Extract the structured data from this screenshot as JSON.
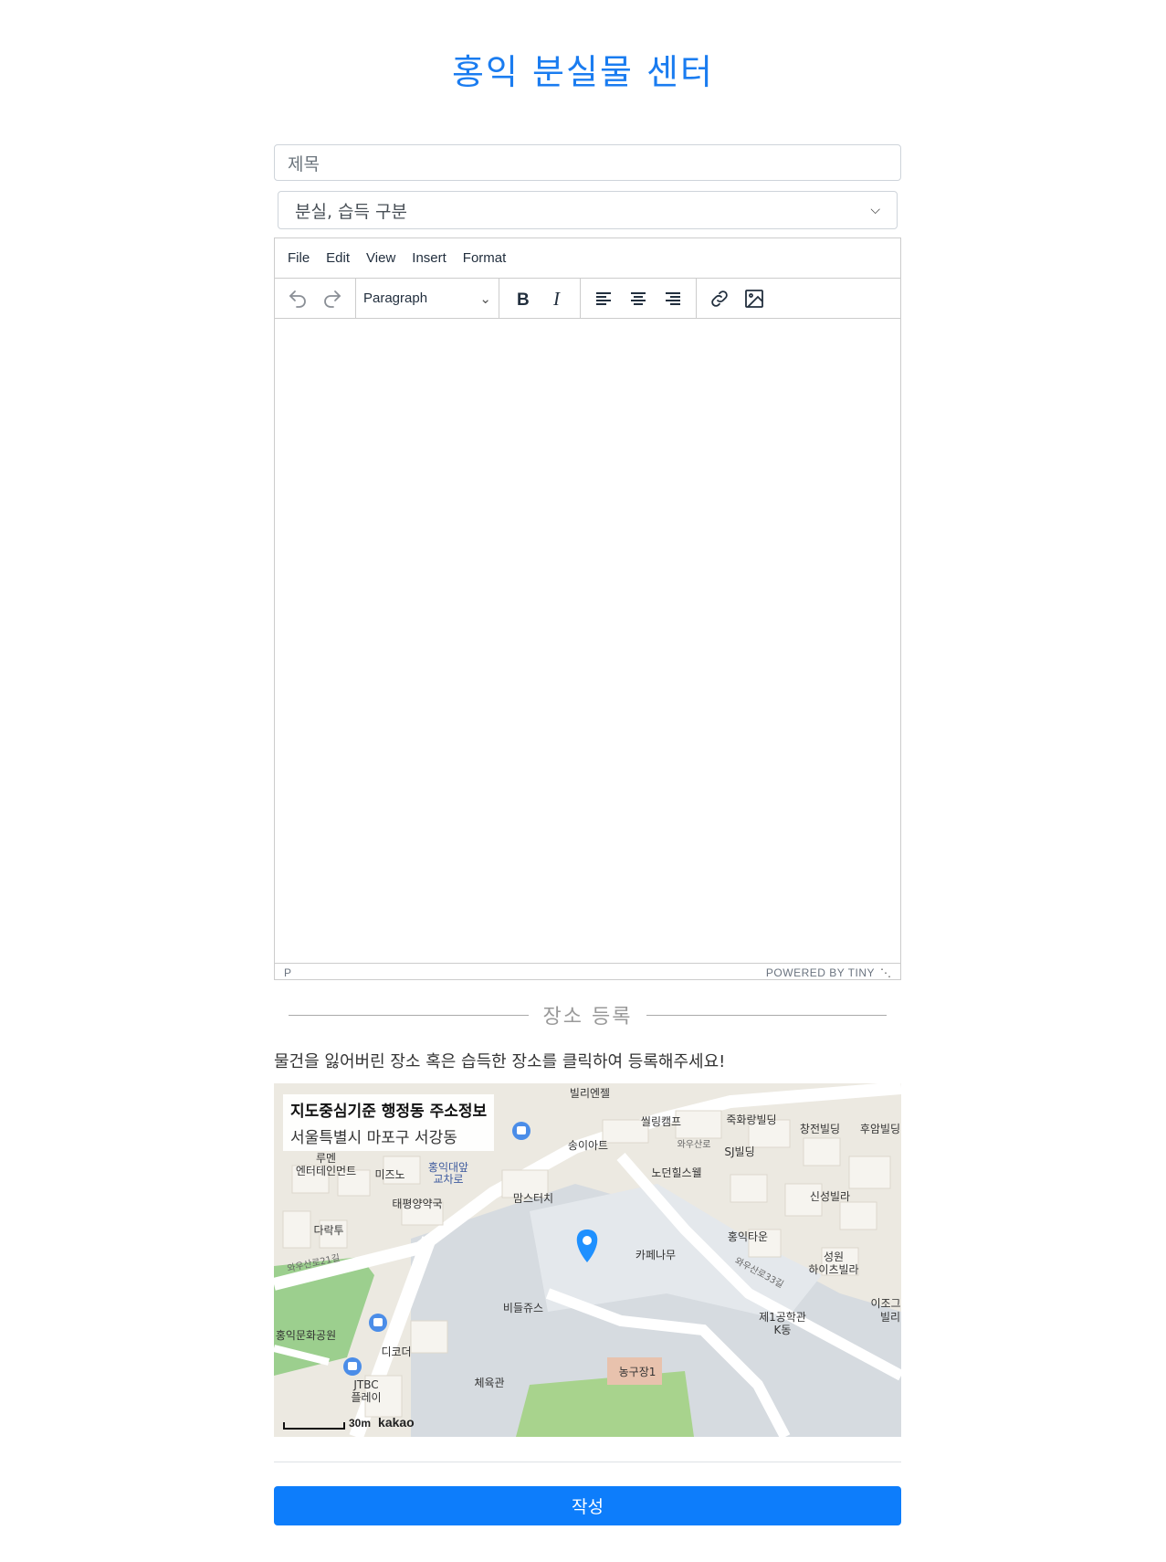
{
  "page_title": "홍익 분실물 센터",
  "form": {
    "title_placeholder": "제목",
    "select_value": "분실, 습득 구분"
  },
  "editor": {
    "menu": [
      "File",
      "Edit",
      "View",
      "Insert",
      "Format"
    ],
    "block_format": "Paragraph",
    "status_path": "P",
    "powered_by": "POWERED BY TINY"
  },
  "location": {
    "section_label": "장소 등록",
    "instruction": "물건을 잃어버린 장소 혹은 습득한 장소를 클릭하여 등록해주세요!",
    "address_title": "지도중심기준 행정동 주소정보",
    "address_value": "서울특별시 마포구 서강동",
    "scale_label": "30m",
    "map_brand": "kakao",
    "map_labels": {
      "l1": "빌리엔젤",
      "l2": "씰링캠프",
      "l3": "죽화랑빌딩",
      "l4": "창전빌딩",
      "l5": "후암빌딩",
      "l6": "송이아트",
      "l7": "SJ빌딩",
      "l8": "노던힐스웰",
      "l9": "루멘",
      "l10": "엔터테인먼트",
      "l11": "미즈노",
      "l12": "홍익대앞",
      "l13": "교차로",
      "l14": "태평양약국",
      "l15": "맘스터치",
      "l16": "신성빌라",
      "l17": "다락투",
      "l18": "카페나무",
      "l19": "홍익타운",
      "l20": "성원",
      "l21": "하이츠빌라",
      "l22": "와우산로21길",
      "l23": "비들쥬스",
      "l24": "홍익문화공원",
      "l25": "제1공학관",
      "l26": "K동",
      "l27": "디코더",
      "l28": "이조그",
      "l29": "빌리",
      "l30": "JTBC",
      "l31": "플레이",
      "l32": "체육관",
      "l33": "농구장1",
      "l34": "와우산로",
      "l35": "와우산로33길"
    }
  },
  "submit_label": "작성"
}
